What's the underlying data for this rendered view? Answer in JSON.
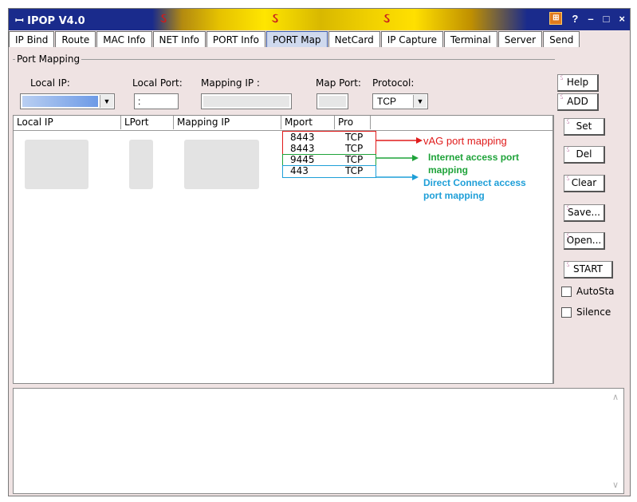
{
  "window": {
    "title": "IPOP V4.0",
    "window_controls": [
      "?",
      "–",
      "□",
      "×"
    ]
  },
  "tabs": [
    "IP Bind",
    "Route",
    "MAC Info",
    "NET Info",
    "PORT Info",
    "PORT Map",
    "NetCard",
    "IP Capture",
    "Terminal",
    "Server",
    "Send"
  ],
  "active_tab": "PORT Map",
  "group": {
    "label": "Port Mapping"
  },
  "form": {
    "local_ip_label": "Local IP:",
    "local_port_label": "Local Port:",
    "mapping_ip_label": "Mapping IP :",
    "map_port_label": "Map Port:",
    "protocol_label": "Protocol:",
    "protocol_value": "TCP",
    "local_port_value": ":"
  },
  "buttons": {
    "help": "Help",
    "add": "ADD",
    "set": "Set",
    "del": "Del",
    "clear": "Clear",
    "save": "Save...",
    "open": "Open...",
    "start": "START"
  },
  "checkboxes": {
    "autosta": "AutoSta",
    "silence": "Silence"
  },
  "table": {
    "columns": [
      "Local IP",
      "LPort",
      "Mapping IP",
      "Mport",
      "Pro"
    ],
    "rows": [
      {
        "mport": "8443",
        "pro": "TCP"
      },
      {
        "mport": "8443",
        "pro": "TCP"
      },
      {
        "mport": "9445",
        "pro": "TCP"
      },
      {
        "mport": "443",
        "pro": "TCP"
      }
    ]
  },
  "annotations": {
    "vag": "vAG port mapping",
    "internet_line1": "Internet access port",
    "internet_line2": "mapping",
    "direct_line1": "Direct Connect access",
    "direct_line2": "port mapping"
  },
  "colors": {
    "red": "#e01b1b",
    "green": "#1fa33a",
    "blue": "#1e9fd8"
  },
  "icons": [
    "app-menu-icon",
    "app-grid-icon",
    "dropdown-arrow-icon",
    "scroll-up-icon",
    "scroll-down-icon"
  ]
}
